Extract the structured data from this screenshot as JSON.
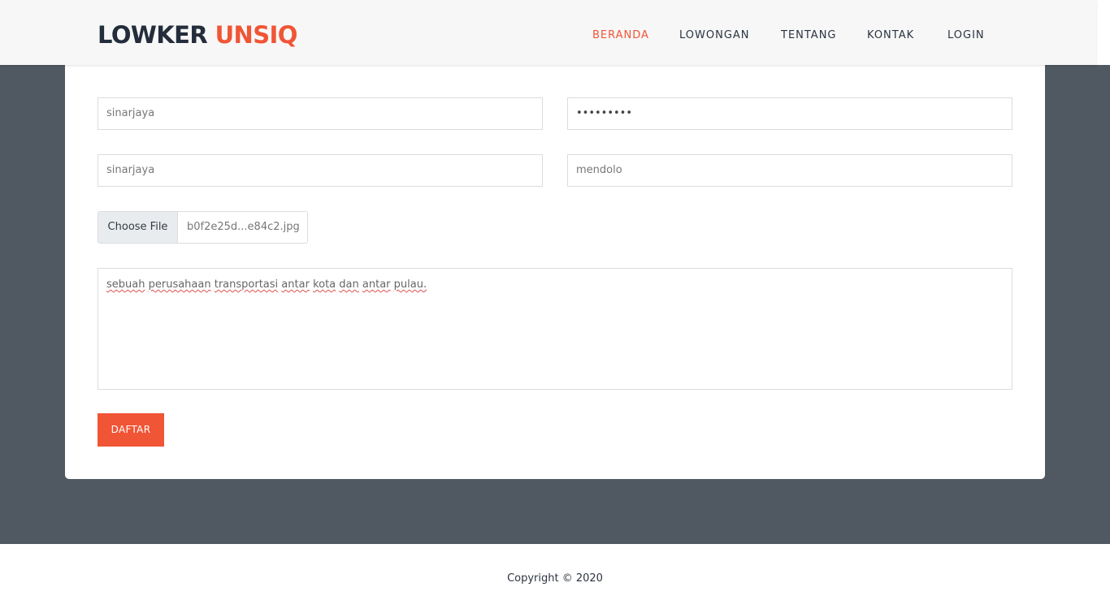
{
  "brand": {
    "part1": "LOWKER",
    "part2": "UNSIQ"
  },
  "nav": {
    "items": [
      {
        "label": "BERANDA",
        "active": true
      },
      {
        "label": "LOWONGAN",
        "active": false
      },
      {
        "label": "TENTANG",
        "active": false
      },
      {
        "label": "KONTAK",
        "active": false
      },
      {
        "label": "LOGIN",
        "active": false
      }
    ]
  },
  "form": {
    "username": "sinarjaya",
    "password": "•••••••••",
    "company_name": "sinarjaya",
    "address": "mendolo",
    "file_button": "Choose File",
    "file_name": "b0f2e25d...e84c2.jpg",
    "description_words": [
      "sebuah",
      "perusahaan",
      "transportasi",
      "antar",
      "kota",
      "dan",
      "antar",
      "pulau."
    ],
    "submit_label": "DAFTAR"
  },
  "footer": {
    "copyright": "Copyright © 2020"
  },
  "colors": {
    "accent": "#f05536",
    "brand_dark": "#232d3b",
    "band": "#505861"
  }
}
